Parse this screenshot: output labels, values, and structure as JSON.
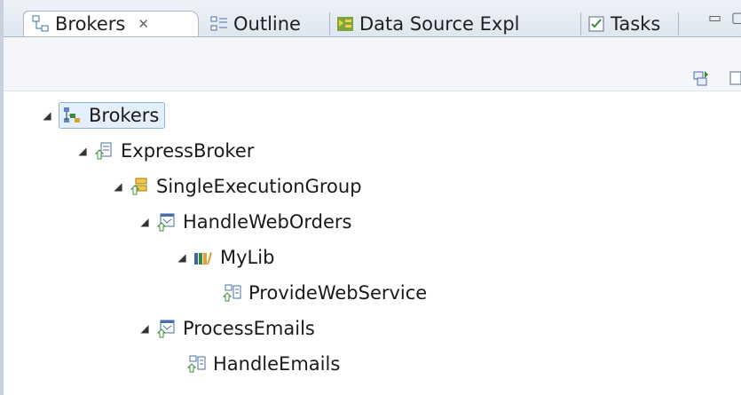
{
  "tabs": [
    {
      "label": "Brokers",
      "close": "✕",
      "icon": "brokers-icon"
    },
    {
      "label": "Outline",
      "icon": "outline-icon"
    },
    {
      "label": "Data Source Expl",
      "icon": "data-source-icon"
    },
    {
      "label": "Tasks",
      "icon": "tasks-icon"
    }
  ],
  "toolbar": {
    "icons": [
      "connect-broker-icon",
      "view-menu-icon"
    ]
  },
  "tree": [
    {
      "label": "Brokers",
      "icon": "brokers-icon",
      "expanded": true,
      "selected": true
    },
    {
      "label": "ExpressBroker",
      "icon": "broker-icon",
      "expanded": true
    },
    {
      "label": "SingleExecutionGroup",
      "icon": "execution-group-icon",
      "expanded": true
    },
    {
      "label": "HandleWebOrders",
      "icon": "application-icon",
      "expanded": true
    },
    {
      "label": "MyLib",
      "icon": "library-icon",
      "expanded": true
    },
    {
      "label": "ProvideWebService",
      "icon": "message-flow-icon"
    },
    {
      "label": "ProcessEmails",
      "icon": "application-icon",
      "expanded": true
    },
    {
      "label": "HandleEmails",
      "icon": "message-flow-icon"
    }
  ],
  "colors": {
    "selection": "#e3effb",
    "selection_border": "#8fb2dc",
    "tab_border": "#a9b7c9"
  }
}
